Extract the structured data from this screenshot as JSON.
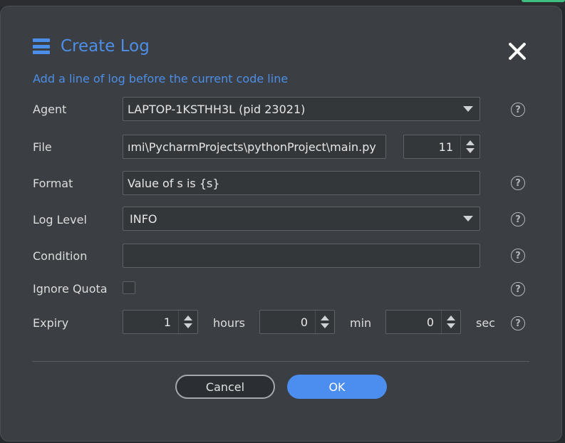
{
  "dialog": {
    "title": "Create Log",
    "subtitle": "Add a line of log before the current code line",
    "close_icon": "close-icon",
    "help_icon_glyph": "?",
    "accent_color": "#4d8fe8"
  },
  "fields": {
    "agent": {
      "label": "Agent",
      "value": "LAPTOP-1KSTHH3L (pid 23021)"
    },
    "file": {
      "label": "File",
      "value": "ımi\\PycharmProjects\\pythonProject\\main.py",
      "line": "11"
    },
    "format": {
      "label": "Format",
      "value": "Value of s is {s}"
    },
    "log_level": {
      "label": "Log Level",
      "value": "INFO"
    },
    "condition": {
      "label": "Condition",
      "value": ""
    },
    "ignore_quota": {
      "label": "Ignore Quota",
      "checked": false
    },
    "expiry": {
      "label": "Expiry",
      "hours": "1",
      "hours_unit": "hours",
      "minutes": "0",
      "minutes_unit": "min",
      "seconds": "0",
      "seconds_unit": "sec"
    }
  },
  "buttons": {
    "cancel": "Cancel",
    "ok": "OK",
    "ok_color": "#4b8ef0"
  }
}
